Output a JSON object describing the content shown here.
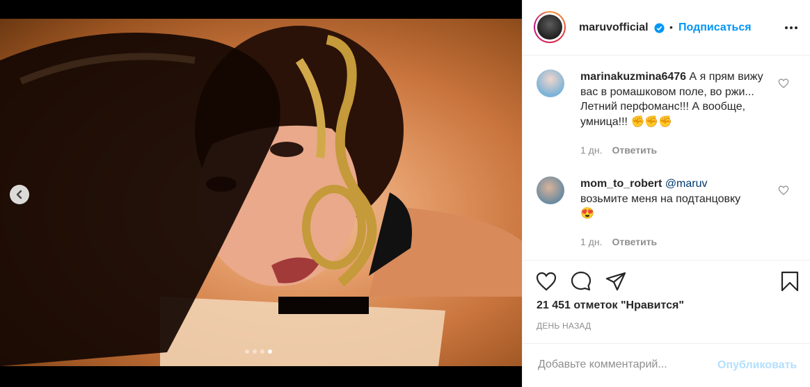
{
  "post": {
    "carousel": {
      "dot_count": 4,
      "active_index": 3,
      "prev_icon": "chevron-left-icon"
    }
  },
  "header": {
    "username": "maruvofficial",
    "verified_icon": "verified-badge-icon",
    "separator": "•",
    "follow_label": "Подписаться",
    "more_icon": "more-horizontal-icon"
  },
  "comments": [
    {
      "username": "marinakuzmina6476",
      "text": "А я прям вижу вас в ромашковом поле, во ржи... Летний перфоманс!!! А вообще, умница!!! ",
      "emoji": "✊✊✊",
      "time": "1 дн.",
      "reply_label": "Ответить"
    },
    {
      "username": "mom_to_robert",
      "mention": "@maruv",
      "text": "возьмите меня на подтанцовку",
      "emoji": "😍",
      "time": "1 дн.",
      "reply_label": "Ответить"
    }
  ],
  "actions": {
    "like_icon": "heart-icon",
    "comment_icon": "comment-bubble-icon",
    "share_icon": "send-icon",
    "save_icon": "bookmark-icon",
    "likes_text": "21 451 отметок \"Нравится\"",
    "time_ago": "ДЕНЬ НАЗАД"
  },
  "comment_box": {
    "placeholder": "Добавьте комментарий...",
    "publish_label": "Опубликовать"
  },
  "colors": {
    "accent": "#0095f6",
    "text": "#262626",
    "muted": "#8e8e8e",
    "publish_disabled": "#b2dffc"
  }
}
